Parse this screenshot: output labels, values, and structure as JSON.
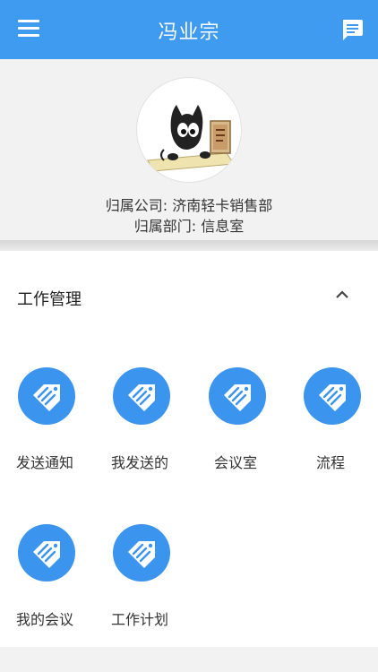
{
  "header": {
    "title": "冯业宗",
    "menu_icon": "menu-icon",
    "message_icon": "chat-message-icon"
  },
  "profile": {
    "avatar_icon": "avatar-cat-image",
    "company_line": "归属公司: 济南轻卡销售部",
    "department_line": "归属部门: 信息室"
  },
  "work": {
    "section_title": "工作管理",
    "collapse_icon": "chevron-up-icon",
    "items": [
      {
        "label": "发送通知",
        "icon": "tag-handshake-icon"
      },
      {
        "label": "我发送的",
        "icon": "tag-handshake-icon"
      },
      {
        "label": "会议室",
        "icon": "tag-handshake-icon"
      },
      {
        "label": "流程",
        "icon": "tag-handshake-icon"
      },
      {
        "label": "我的会议",
        "icon": "tag-handshake-icon"
      },
      {
        "label": "工作计划",
        "icon": "tag-handshake-icon"
      }
    ]
  },
  "colors": {
    "primary": "#3f9bef",
    "icon_circle": "#3b94ee",
    "background": "#f2f2f2"
  }
}
